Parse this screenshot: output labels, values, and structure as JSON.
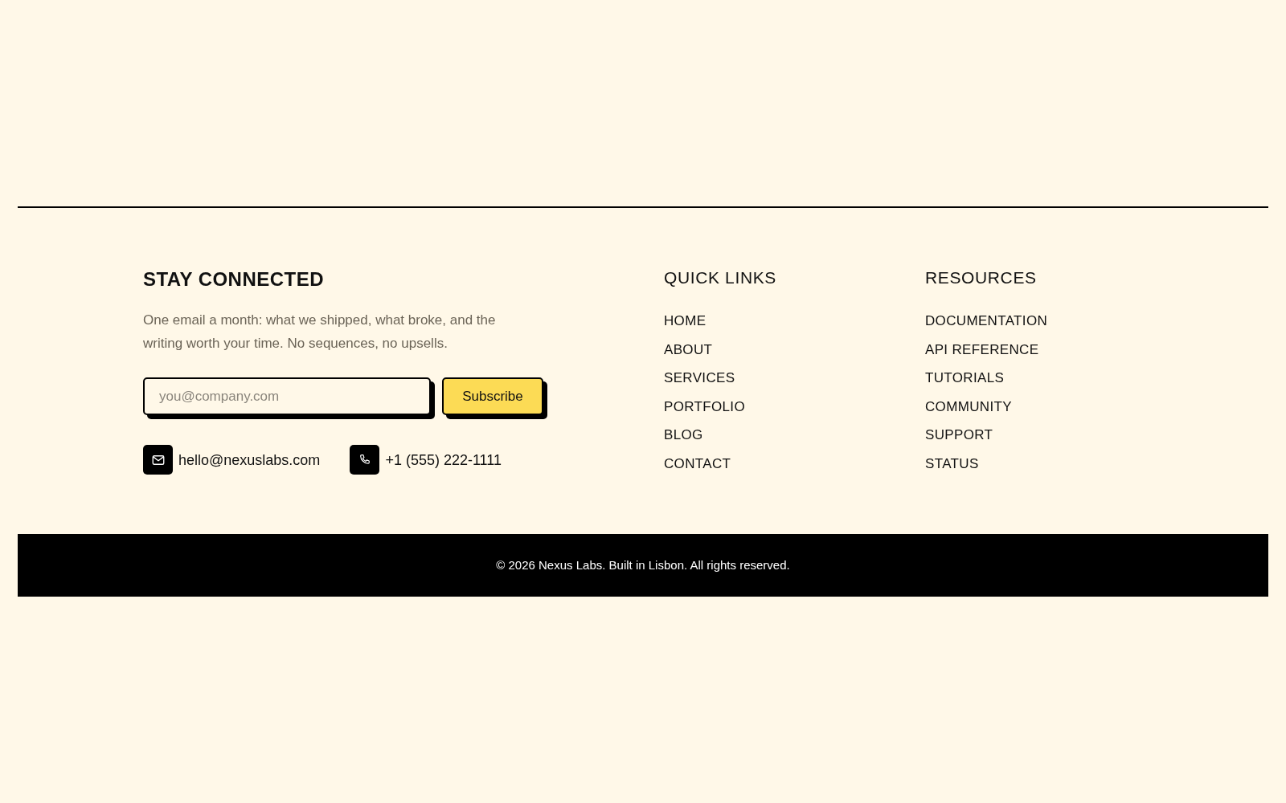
{
  "newsletter": {
    "heading": "STAY CONNECTED",
    "description": "One email a month: what we shipped, what broke, and the writing worth your time. No sequences, no upsells.",
    "email_field": {
      "placeholder": "you@company.com"
    },
    "subscribe_button": "Subscribe"
  },
  "contacts": [
    {
      "kind": "email",
      "text": "hello@nexuslabs.com"
    },
    {
      "kind": "phone",
      "text": "+1 (555) 222-1111"
    }
  ],
  "link_columns": [
    {
      "heading": "QUICK LINKS",
      "links": [
        "HOME",
        "ABOUT",
        "SERVICES",
        "PORTFOLIO",
        "BLOG",
        "CONTACT"
      ]
    },
    {
      "heading": "RESOURCES",
      "links": [
        "DOCUMENTATION",
        "API REFERENCE",
        "TUTORIALS",
        "COMMUNITY",
        "SUPPORT",
        "STATUS"
      ]
    }
  ],
  "copyright": "© 2026 Nexus Labs. Built in Lisbon. All rights reserved."
}
